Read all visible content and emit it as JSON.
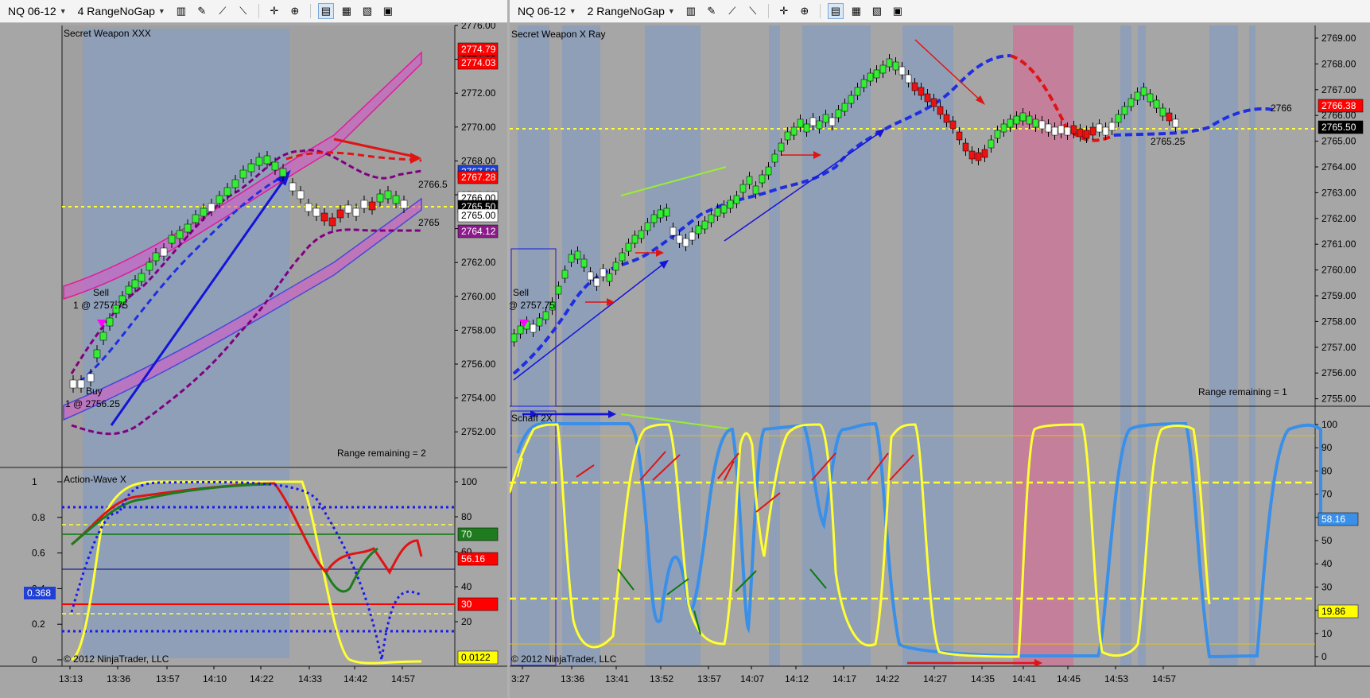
{
  "left": {
    "toolbar": {
      "instrument": "NQ 06-12",
      "period": "4 RangeNoGap"
    },
    "price_panel": {
      "title": "Secret Weapon XXX",
      "axis_ticks": [
        "2776.00",
        "2774.00",
        "2772.00",
        "2770.00",
        "2768.00",
        "2766.00",
        "2764.00",
        "2762.00",
        "2760.00",
        "2758.00",
        "2756.00",
        "2754.00",
        "2752.00"
      ],
      "markers": [
        {
          "text": "2774.79",
          "bg": "#ff0000",
          "fg": "#ffffff"
        },
        {
          "text": "2774.03",
          "bg": "#ff0000",
          "fg": "#ffffff"
        },
        {
          "text": "2767.50",
          "bg": "#1f3fd6",
          "fg": "#ffffff"
        },
        {
          "text": "2767.28",
          "bg": "#ff0000",
          "fg": "#ffffff"
        },
        {
          "text": "2766.00",
          "bg": "#ffffff",
          "fg": "#000000"
        },
        {
          "text": "2765.50",
          "bg": "#000000",
          "fg": "#ffffff"
        },
        {
          "text": "2765.00",
          "bg": "#ffffff",
          "fg": "#000000"
        },
        {
          "text": "2764.12",
          "bg": "#8b1a8b",
          "fg": "#ffffff"
        }
      ],
      "range_remaining": "Range remaining = 2",
      "sell_label": "Sell",
      "sell_detail": "1 @ 2757.75",
      "buy_label": "Buy",
      "buy_detail": "1 @ 2756.25",
      "last_high": "2766.5",
      "last_low": "2765"
    },
    "indicator_panel": {
      "title": "Action-Wave X",
      "axis_ticks": [
        "100",
        "80",
        "60",
        "40",
        "20"
      ],
      "left_ticks": [
        "1",
        "0.8",
        "0.6",
        "0.4",
        "0.2",
        "0"
      ],
      "left_marker": "0.368",
      "markers": [
        {
          "text": "70",
          "bg": "#1e7b1e",
          "fg": "#ffffff"
        },
        {
          "text": "56.16",
          "bg": "#ff0000",
          "fg": "#ffffff"
        },
        {
          "text": "30",
          "bg": "#ff0000",
          "fg": "#ffffff"
        },
        {
          "text": "0.0122",
          "bg": "#ffff00",
          "fg": "#000000"
        }
      ],
      "copyright": "© 2012 NinjaTrader, LLC"
    },
    "time_ticks": [
      "13:13",
      "13:36",
      "13:57",
      "14:10",
      "14:22",
      "14:33",
      "14:42",
      "14:57"
    ]
  },
  "right": {
    "toolbar": {
      "instrument": "NQ 06-12",
      "period": "2 RangeNoGap"
    },
    "price_panel": {
      "title": "Secret Weapon  X Ray",
      "axis_ticks": [
        "2769.00",
        "2768.00",
        "2767.00",
        "2766.00",
        "2765.00",
        "2764.00",
        "2763.00",
        "2762.00",
        "2761.00",
        "2760.00",
        "2759.00",
        "2758.00",
        "2757.00",
        "2756.00",
        "2755.00"
      ],
      "markers": [
        {
          "text": "2766.38",
          "bg": "#ff0000",
          "fg": "#ffffff"
        },
        {
          "text": "2765.50",
          "bg": "#000000",
          "fg": "#ffffff"
        }
      ],
      "range_remaining": "Range remaining = 1",
      "sell_label": "Sell",
      "sell_detail": "@ 2757.75",
      "last_high": "2766",
      "last_low": "2765.25"
    },
    "indicator_panel": {
      "title": "Schaff 2X",
      "axis_ticks": [
        "100",
        "90",
        "80",
        "70",
        "60",
        "50",
        "40",
        "30",
        "20",
        "10",
        "0"
      ],
      "markers": [
        {
          "text": "58.16",
          "bg": "#3a8fe8",
          "fg": "#ffffff"
        },
        {
          "text": "19.86",
          "bg": "#ffff00",
          "fg": "#000000"
        }
      ],
      "copyright": "© 2012 NinjaTrader, LLC"
    },
    "time_ticks": [
      "3:27",
      "13:36",
      "13:41",
      "13:52",
      "13:57",
      "14:07",
      "14:12",
      "14:17",
      "14:22",
      "14:27",
      "14:35",
      "14:41",
      "14:45",
      "14:53",
      "14:57"
    ]
  }
}
